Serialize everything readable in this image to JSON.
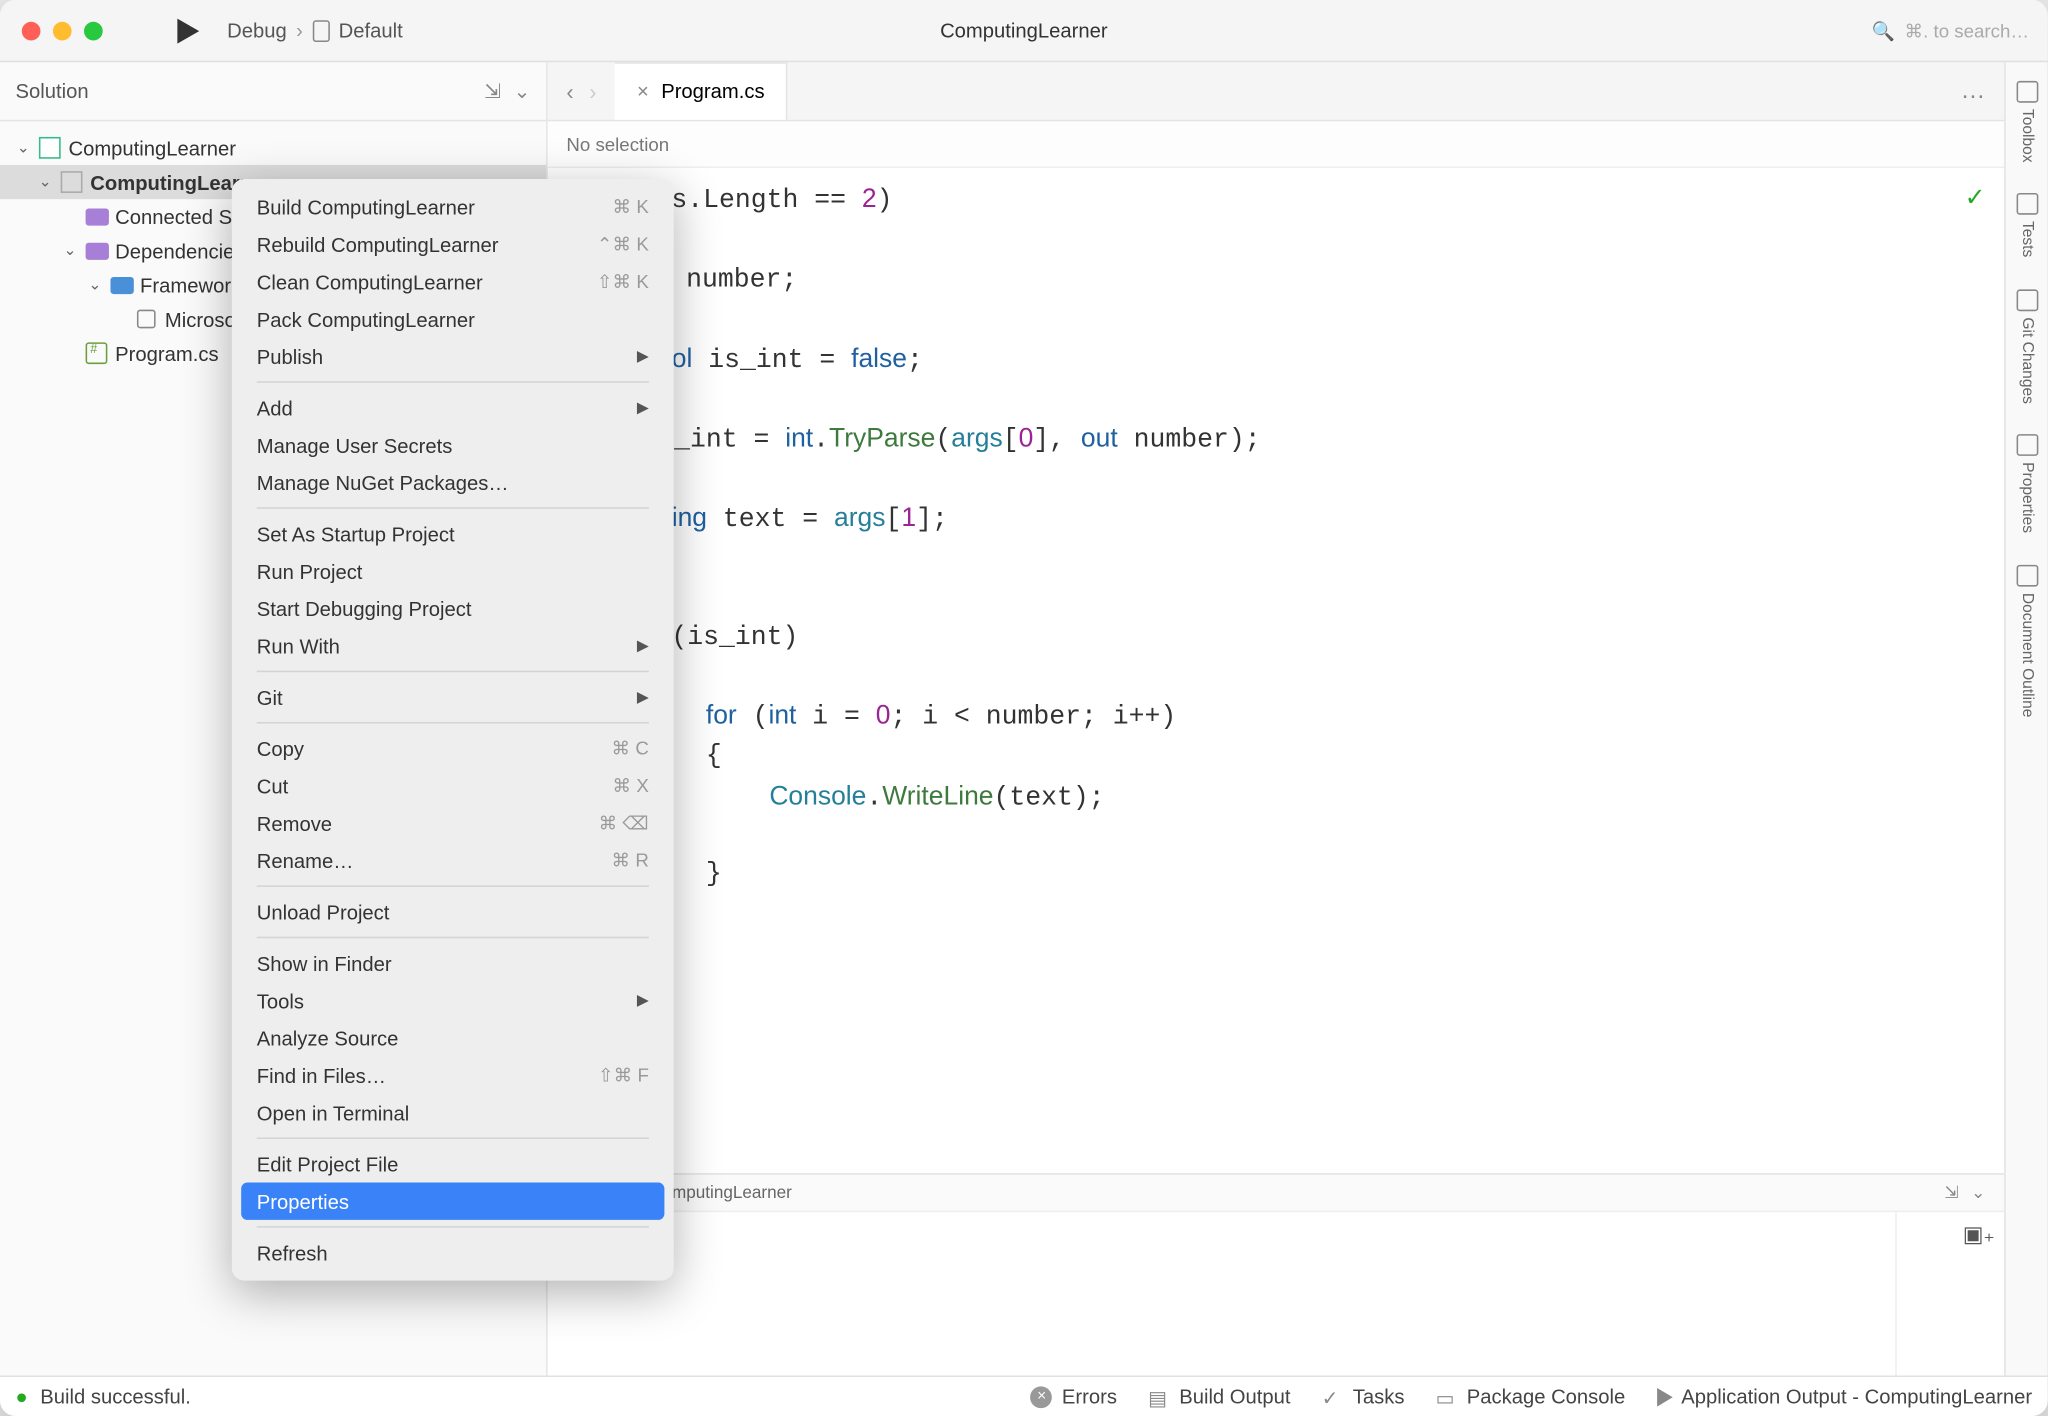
{
  "titlebar": {
    "config": "Debug",
    "target": "Default",
    "title": "ComputingLearner",
    "search_placeholder": "⌘. to search…"
  },
  "sidebar": {
    "header": "Solution",
    "tree": {
      "solution": "ComputingLearner",
      "project": "ComputingLearner",
      "connected": "Connected Services",
      "deps": "Dependencies",
      "frameworks": "Frameworks",
      "pkg": "Microsoft.NETCore.App",
      "file": "Program.cs"
    }
  },
  "context_menu": [
    {
      "t": "item",
      "label": "Build ComputingLearner",
      "short": "⌘ K"
    },
    {
      "t": "item",
      "label": "Rebuild ComputingLearner",
      "short": "⌃⌘ K"
    },
    {
      "t": "item",
      "label": "Clean ComputingLearner",
      "short": "⇧⌘ K"
    },
    {
      "t": "item",
      "label": "Pack ComputingLearner"
    },
    {
      "t": "item",
      "label": "Publish",
      "sub": true
    },
    {
      "t": "sep"
    },
    {
      "t": "item",
      "label": "Add",
      "sub": true
    },
    {
      "t": "item",
      "label": "Manage User Secrets"
    },
    {
      "t": "item",
      "label": "Manage NuGet Packages…"
    },
    {
      "t": "sep"
    },
    {
      "t": "item",
      "label": "Set As Startup Project"
    },
    {
      "t": "item",
      "label": "Run Project"
    },
    {
      "t": "item",
      "label": "Start Debugging Project"
    },
    {
      "t": "item",
      "label": "Run With",
      "sub": true
    },
    {
      "t": "sep"
    },
    {
      "t": "item",
      "label": "Git",
      "sub": true
    },
    {
      "t": "sep"
    },
    {
      "t": "item",
      "label": "Copy",
      "short": "⌘ C"
    },
    {
      "t": "item",
      "label": "Cut",
      "short": "⌘ X"
    },
    {
      "t": "item",
      "label": "Remove",
      "short": "⌘ ⌫"
    },
    {
      "t": "item",
      "label": "Rename…",
      "short": "⌘ R"
    },
    {
      "t": "sep"
    },
    {
      "t": "item",
      "label": "Unload Project"
    },
    {
      "t": "sep"
    },
    {
      "t": "item",
      "label": "Show in Finder"
    },
    {
      "t": "item",
      "label": "Tools",
      "sub": true
    },
    {
      "t": "item",
      "label": "Analyze Source"
    },
    {
      "t": "item",
      "label": "Find in Files…",
      "short": "⇧⌘ F"
    },
    {
      "t": "item",
      "label": "Open in Terminal"
    },
    {
      "t": "sep"
    },
    {
      "t": "item",
      "label": "Edit Project File"
    },
    {
      "t": "item",
      "label": "Properties",
      "hl": true
    },
    {
      "t": "sep"
    },
    {
      "t": "item",
      "label": "Refresh"
    }
  ],
  "editor": {
    "tab": "Program.cs",
    "breadcrumb": "No selection"
  },
  "right_rail": [
    "Toolbox",
    "Tests",
    "Git Changes",
    "Properties",
    "Document Outline"
  ],
  "bottom_panel": {
    "title": "Terminal – ComputingLearner"
  },
  "status": {
    "msg": "Build successful.",
    "items": {
      "errors": "Errors",
      "build": "Build Output",
      "tasks": "Tasks",
      "pkg": "Package Console",
      "app": "Application Output - ComputingLearner"
    }
  }
}
